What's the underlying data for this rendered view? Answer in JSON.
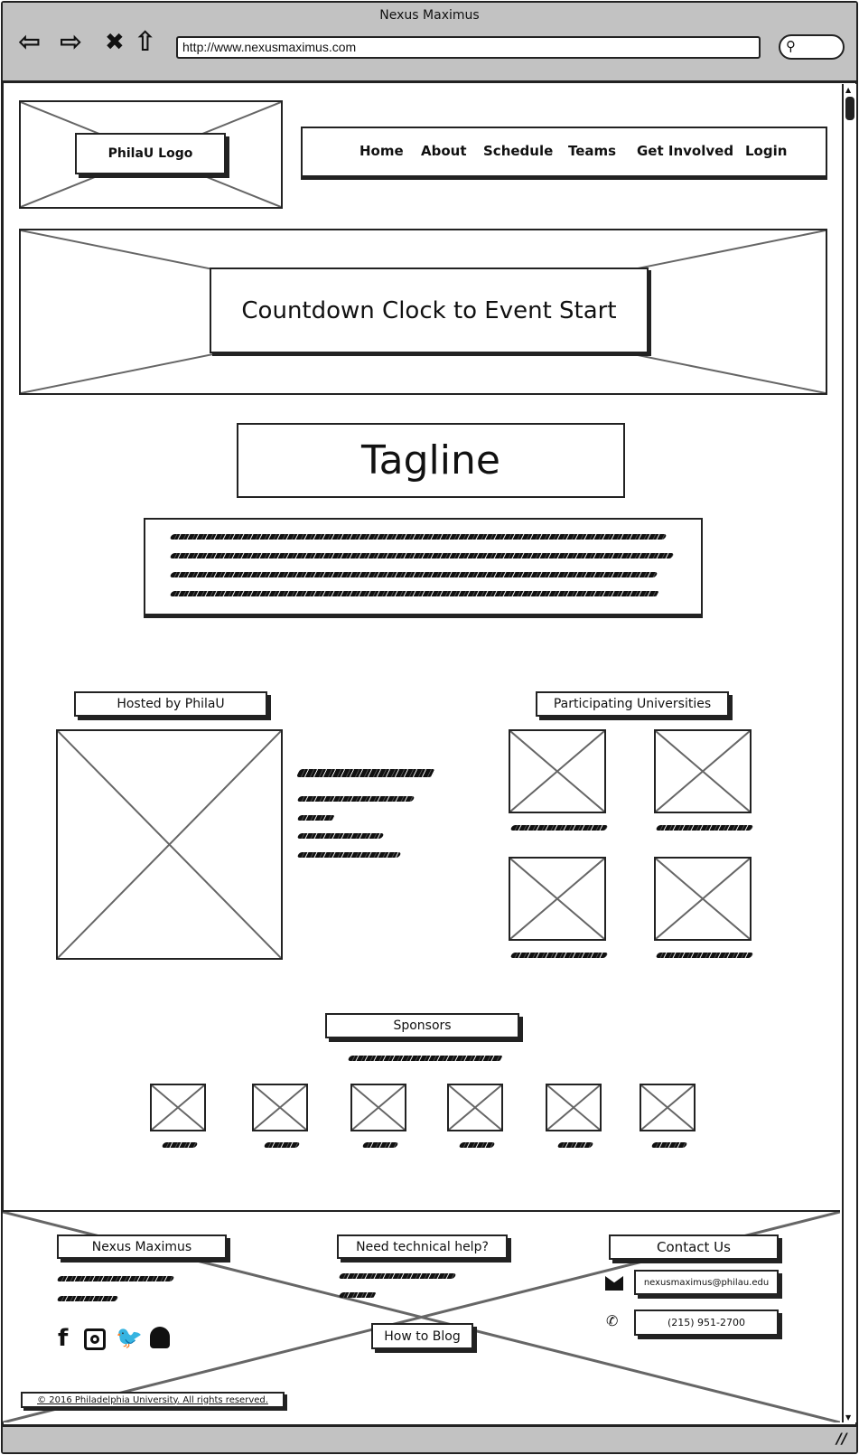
{
  "browser": {
    "title": "Nexus Maximus",
    "url": "http://www.nexusmaximus.com",
    "icons": [
      "back-arrow-icon",
      "forward-arrow-icon",
      "stop-icon",
      "home-icon",
      "search-icon"
    ]
  },
  "header": {
    "logo_label": "PhilaU Logo",
    "nav": [
      "Home",
      "About",
      "Schedule",
      "Teams",
      "Get Involved",
      "Login"
    ]
  },
  "hero": {
    "countdown_label": "Countdown Clock to Event Start"
  },
  "tagline": "Tagline",
  "hosted": {
    "label": "Hosted by PhilaU"
  },
  "universities": {
    "label": "Participating Universities"
  },
  "sponsors": {
    "label": "Sponsors"
  },
  "footer": {
    "col1_title": "Nexus Maximus",
    "col2_title": "Need technical help?",
    "blog_button": "How to Blog",
    "col3_title": "Contact Us",
    "email": "nexusmaximus@philau.edu",
    "phone": "(215) 951-2700",
    "social_icons": [
      "facebook-icon",
      "instagram-icon",
      "twitter-icon",
      "snapchat-icon"
    ],
    "copyright": "© 2016 Philadelphia University. All rights reserved."
  }
}
